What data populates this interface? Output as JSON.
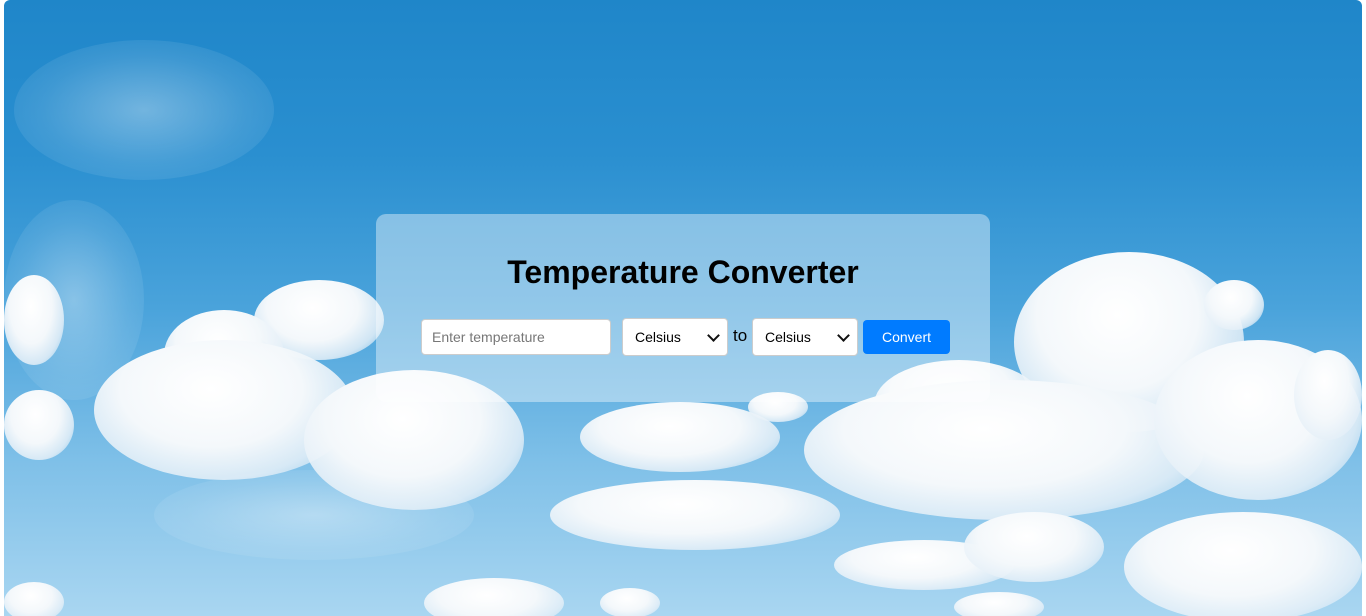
{
  "converter": {
    "title": "Temperature Converter",
    "input": {
      "placeholder": "Enter temperature",
      "value": ""
    },
    "from_unit": {
      "selected": "Celsius"
    },
    "separator": "to",
    "to_unit": {
      "selected": "Celsius"
    },
    "convert_label": "Convert"
  },
  "colors": {
    "sky": "#1f86c9",
    "button": "#007bff",
    "panel": "rgba(255,255,255,0.4)"
  },
  "icons": {
    "select_indicator": "chevron-down-icon"
  }
}
